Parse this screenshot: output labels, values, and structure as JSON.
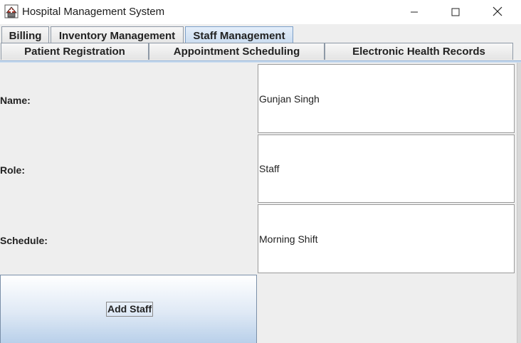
{
  "window": {
    "title": "Hospital Management System"
  },
  "tabs": {
    "row1": [
      {
        "label": "Billing"
      },
      {
        "label": "Inventory Management"
      },
      {
        "label": "Staff Management",
        "selected": true
      }
    ],
    "row2": [
      {
        "label": "Patient Registration"
      },
      {
        "label": "Appointment Scheduling"
      },
      {
        "label": "Electronic Health Records"
      }
    ]
  },
  "form": {
    "name_label": "Name:",
    "name_value": "Gunjan Singh",
    "role_label": "Role:",
    "role_value": "Staff",
    "schedule_label": "Schedule:",
    "schedule_value": "Morning Shift"
  },
  "actions": {
    "add_staff_label": "Add Staff"
  },
  "colors": {
    "selected_tab": "#c9dbef",
    "button_gradient_bottom": "#b9d0ea"
  }
}
